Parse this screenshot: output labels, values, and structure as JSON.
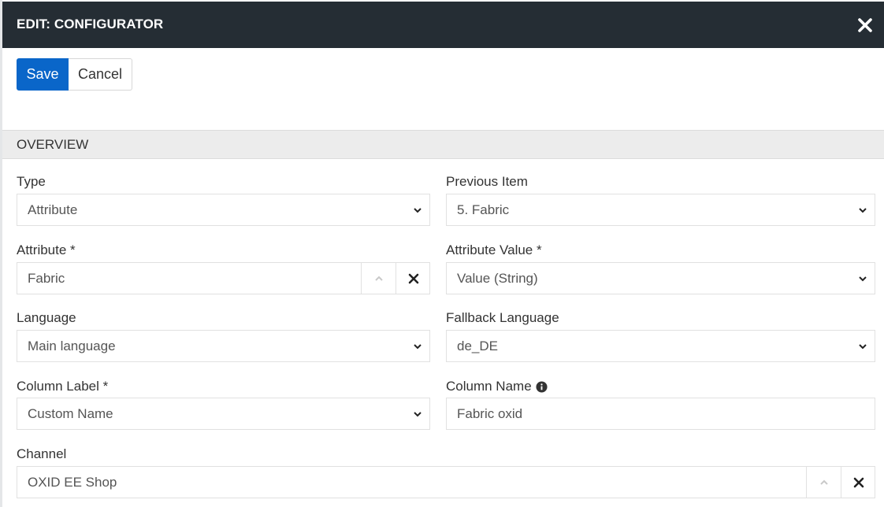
{
  "header": {
    "title": "EDIT: CONFIGURATOR",
    "close_icon": "close-icon"
  },
  "actions": {
    "save_label": "Save",
    "cancel_label": "Cancel"
  },
  "section": {
    "title": "OVERVIEW"
  },
  "fields": {
    "type": {
      "label": "Type",
      "value": "Attribute"
    },
    "previous_item": {
      "label": "Previous Item",
      "value": "5. Fabric"
    },
    "attribute": {
      "label": "Attribute *",
      "value": "Fabric"
    },
    "attribute_value": {
      "label": "Attribute Value *",
      "value": "Value (String)"
    },
    "language": {
      "label": "Language",
      "value": "Main language"
    },
    "fallback_language": {
      "label": "Fallback Language",
      "value": "de_DE"
    },
    "column_label": {
      "label": "Column Label *",
      "value": "Custom Name"
    },
    "column_name": {
      "label": "Column Name",
      "value": "Fabric oxid"
    },
    "channel": {
      "label": "Channel",
      "value": "OXID EE Shop"
    }
  },
  "colors": {
    "header_bg": "#252d34",
    "primary": "#0a66c9",
    "section_bg": "#ececec"
  }
}
